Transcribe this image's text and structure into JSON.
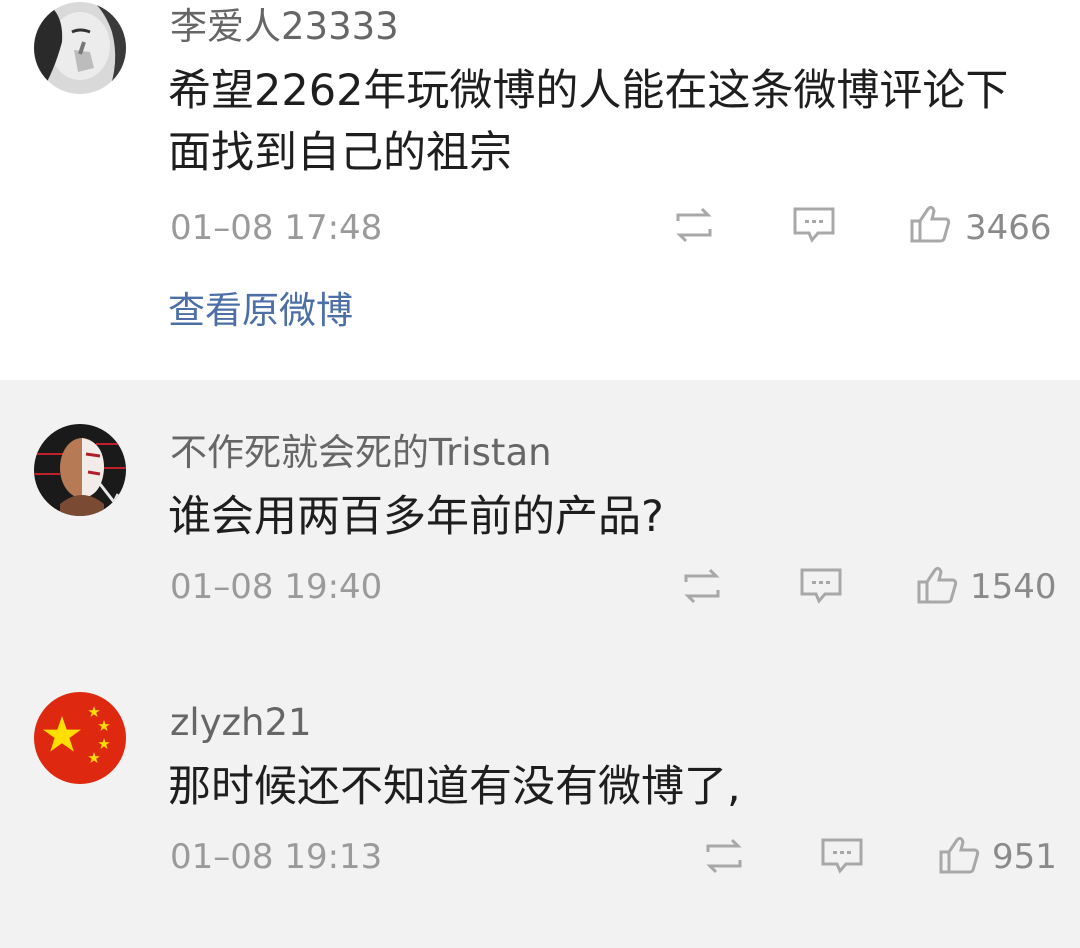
{
  "comments": [
    {
      "username": "李爱人23333",
      "text": "希望2262年玩微博的人能在这条微博评论下面找到自己的祖宗",
      "time": "01–08 17:48",
      "likes": "3466",
      "link_label": "查看原微博",
      "avatar_icon": "person-covering-mouth-avatar"
    },
    {
      "username": "不作死就会死的Tristan",
      "text": "谁会用两百多年前的产品?",
      "time": "01–08 19:40",
      "likes": "1540",
      "avatar_icon": "masked-face-avatar"
    },
    {
      "username": "zlyzh21",
      "text": "那时候还不知道有没有微博了,",
      "time": "01–08 19:13",
      "likes": "951",
      "avatar_icon": "china-flag-avatar"
    }
  ],
  "icons": {
    "repost": "repost-icon",
    "comment": "comment-icon",
    "like": "thumbs-up-icon"
  },
  "colors": {
    "link": "#4b6fa6",
    "meta": "#9a9a9a",
    "flag_red": "#de2910",
    "flag_yellow": "#ffde00"
  }
}
